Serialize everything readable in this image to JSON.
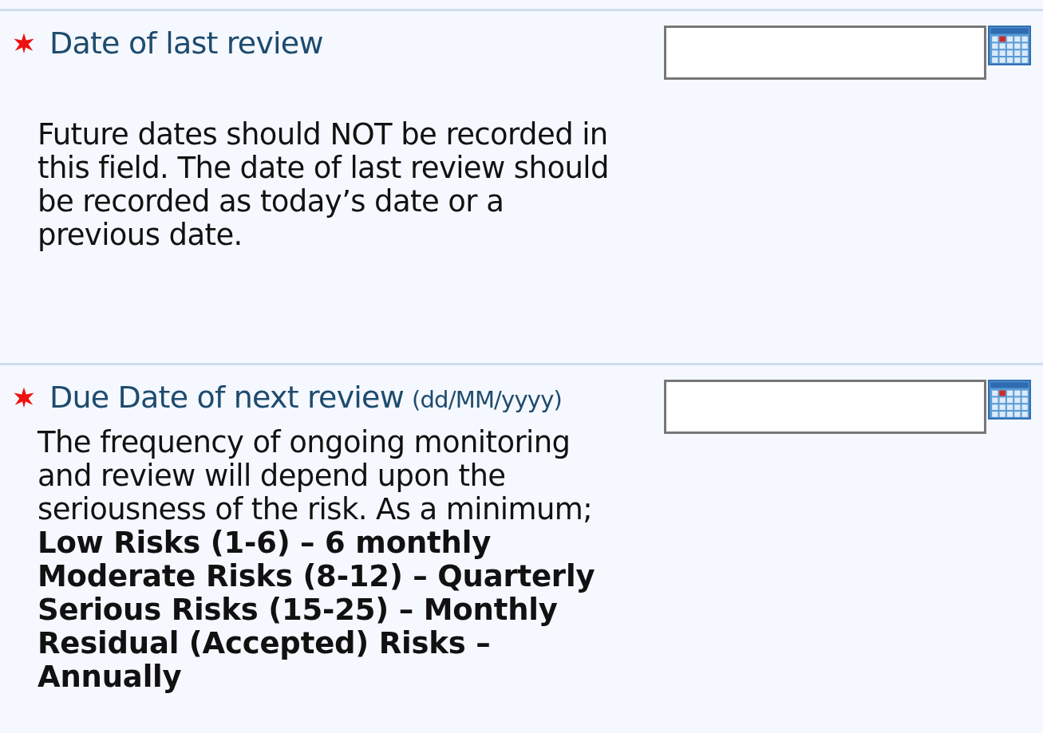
{
  "fields": [
    {
      "label": "Date of last review",
      "required": true,
      "description": [
        {
          "text": "Future dates should NOT be recorded in this field. The date of last review should be recorded as today’s date or a previous date.",
          "bold": false
        }
      ]
    },
    {
      "label": "Due Date of next review",
      "required": true,
      "format_hint": "(dd/MM/yyyy)",
      "description": [
        {
          "text": "The frequency of ongoing monitoring and review will depend upon the seriousness of the risk. As a minimum;",
          "bold": false
        },
        {
          "text": "Low Risks (1-6) – 6 monthly",
          "bold": true
        },
        {
          "text": "Moderate Risks (8-12) – Quarterly",
          "bold": true
        },
        {
          "text": "Serious Risks (15-25) – Monthly",
          "bold": true
        },
        {
          "text": "Residual (Accepted) Risks – Annually",
          "bold": true
        }
      ]
    }
  ]
}
